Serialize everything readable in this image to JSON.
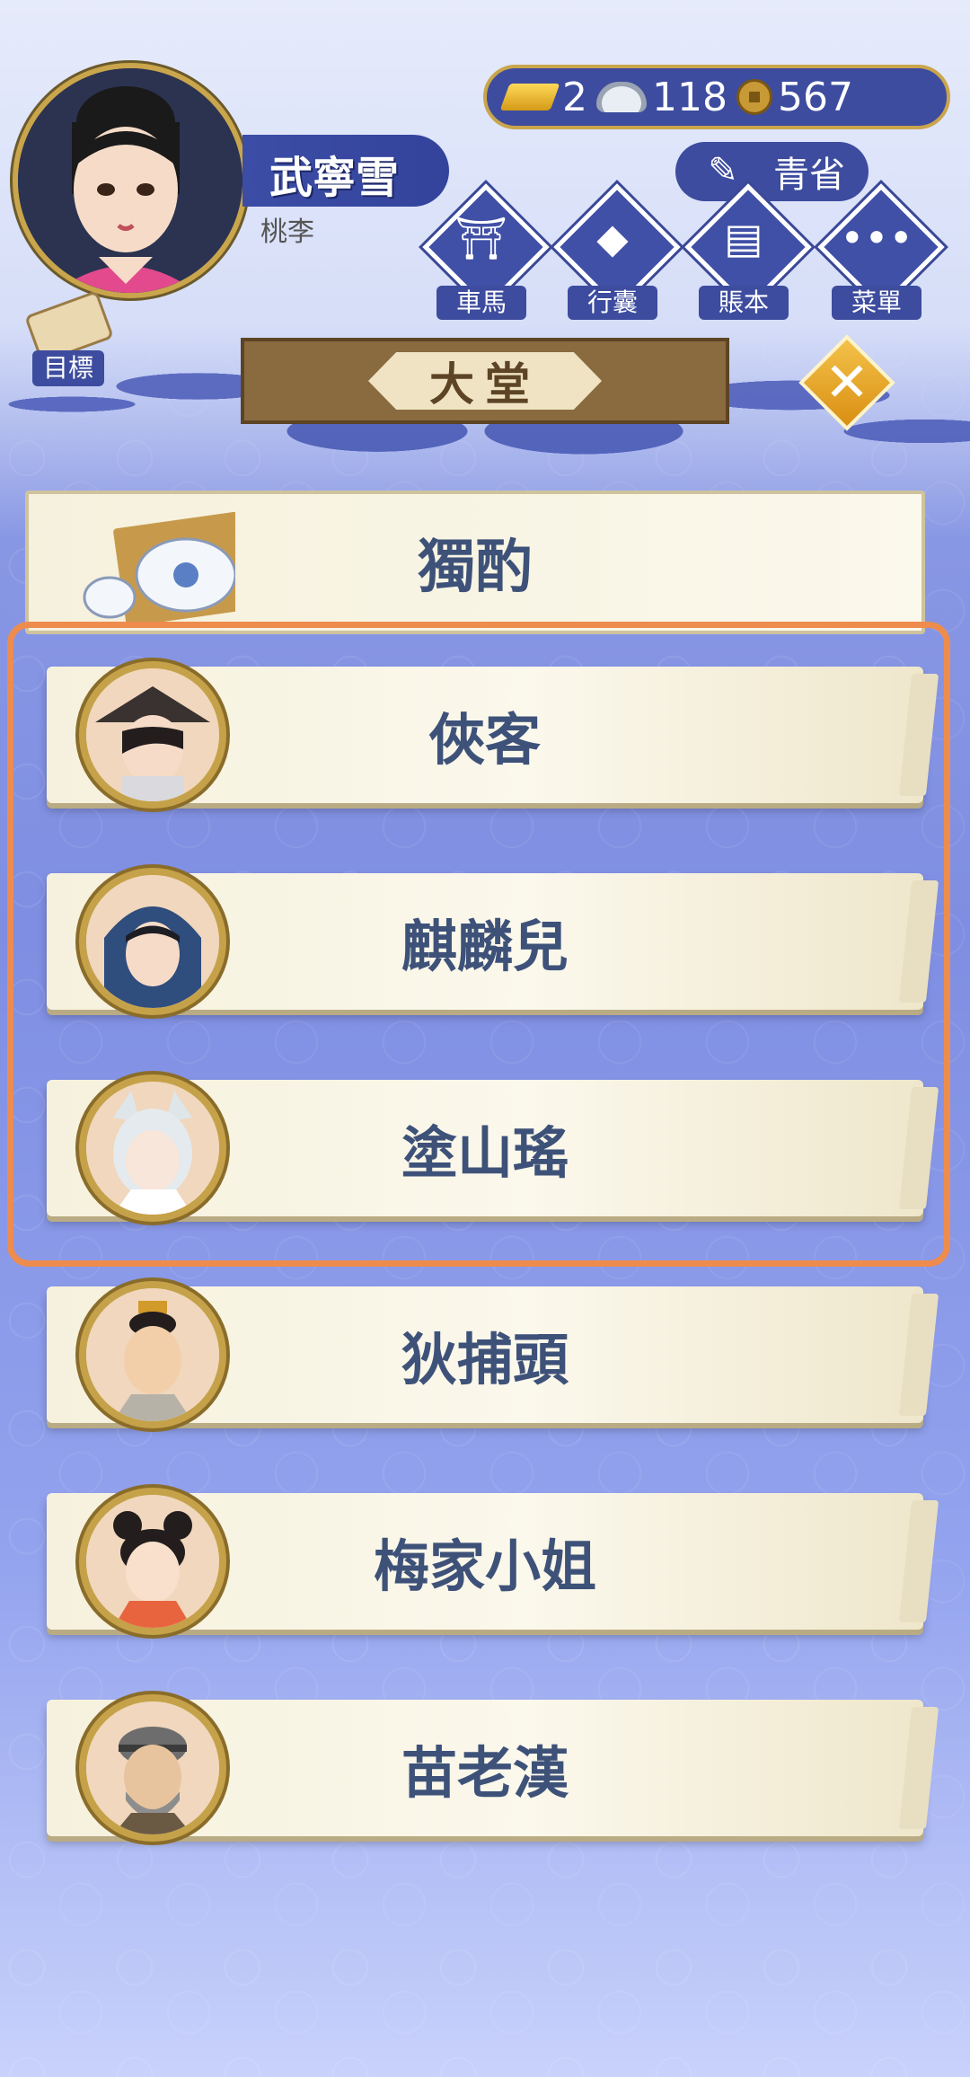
{
  "player": {
    "name": "武寧雪",
    "title": "桃李"
  },
  "currency": {
    "gold": "2",
    "silver": "118",
    "coins": "567"
  },
  "reflect_label": "青省",
  "menu": [
    {
      "label": "車馬",
      "icon": "carriage-icon"
    },
    {
      "label": "行囊",
      "icon": "bag-icon"
    },
    {
      "label": "賬本",
      "icon": "ledger-icon"
    },
    {
      "label": "菜單",
      "icon": "more-icon"
    }
  ],
  "goal_label": "目標",
  "hall_title": "大堂",
  "options": [
    {
      "label": "獨酌"
    },
    {
      "label": "俠客"
    },
    {
      "label": "麒麟兒"
    },
    {
      "label": "塗山瑤"
    },
    {
      "label": "狄捕頭"
    },
    {
      "label": "梅家小姐"
    },
    {
      "label": "苗老漢"
    }
  ],
  "colors": {
    "highlight": "#ee8c4d",
    "card_text": "#3e5279",
    "panel_blue": "#3d4c9e"
  }
}
